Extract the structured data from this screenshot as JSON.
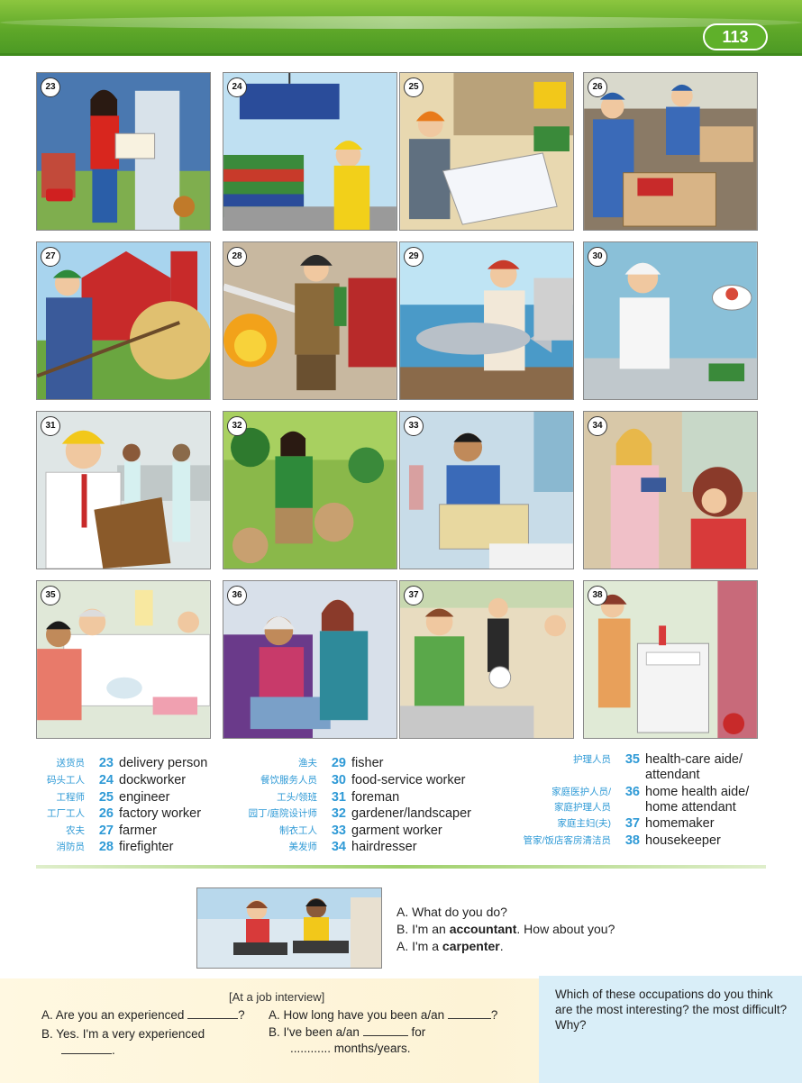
{
  "page_number": "113",
  "pictures": [
    {
      "num": "23",
      "name": "delivery-person"
    },
    {
      "num": "24",
      "name": "dockworker"
    },
    {
      "num": "25",
      "name": "engineer"
    },
    {
      "num": "26",
      "name": "factory-worker"
    },
    {
      "num": "27",
      "name": "farmer"
    },
    {
      "num": "28",
      "name": "firefighter"
    },
    {
      "num": "29",
      "name": "fisher"
    },
    {
      "num": "30",
      "name": "food-service-worker"
    },
    {
      "num": "31",
      "name": "foreman"
    },
    {
      "num": "32",
      "name": "gardener"
    },
    {
      "num": "33",
      "name": "garment-worker"
    },
    {
      "num": "34",
      "name": "hairdresser"
    },
    {
      "num": "35",
      "name": "health-care-aide"
    },
    {
      "num": "36",
      "name": "home-health-aide"
    },
    {
      "num": "37",
      "name": "homemaker"
    },
    {
      "num": "38",
      "name": "housekeeper"
    }
  ],
  "legend": {
    "col1": [
      {
        "zh": "送货员",
        "num": "23",
        "en": "delivery person"
      },
      {
        "zh": "码头工人",
        "num": "24",
        "en": "dockworker"
      },
      {
        "zh": "工程师",
        "num": "25",
        "en": "engineer"
      },
      {
        "zh": "工厂工人",
        "num": "26",
        "en": "factory worker"
      },
      {
        "zh": "农夫",
        "num": "27",
        "en": "farmer"
      },
      {
        "zh": "消防员",
        "num": "28",
        "en": "firefighter"
      }
    ],
    "col2": [
      {
        "zh": "渔夫",
        "num": "29",
        "en": "fisher"
      },
      {
        "zh": "餐饮服务人员",
        "num": "30",
        "en": "food-service worker"
      },
      {
        "zh": "工头/领班",
        "num": "31",
        "en": "foreman"
      },
      {
        "zh": "园丁/庭院设计师",
        "num": "32",
        "en": "gardener/landscaper"
      },
      {
        "zh": "制衣工人",
        "num": "33",
        "en": "garment worker"
      },
      {
        "zh": "美发师",
        "num": "34",
        "en": "hairdresser"
      }
    ],
    "col3": [
      {
        "zh": "护理人员",
        "num": "35",
        "en": "health-care aide/",
        "en2": "attendant"
      },
      {
        "zh": "家庭医护人员/",
        "zh2": "家庭护理人员",
        "num": "36",
        "en": "home health aide/",
        "en2": "home attendant"
      },
      {
        "zh": "家庭主妇(夫)",
        "num": "37",
        "en": "homemaker"
      },
      {
        "zh": "管家/饭店客房清洁员",
        "num": "38",
        "en": "housekeeper"
      }
    ]
  },
  "conversation": {
    "a1": "A. What do you do?",
    "b_pre": "B. I'm an ",
    "b_bold": "accountant",
    "b_post": ". How about you?",
    "a2_pre": "A. I'm a ",
    "a2_bold": "carpenter",
    "a2_post": "."
  },
  "interview": {
    "heading": "[At a job interview]",
    "a1_pre": "A.  Are you an experienced",
    "a1_post": "?",
    "b1": "B.  Yes. I'm a very experienced",
    "b1_end": ".",
    "a2_pre": "A.  How long have you been a/an",
    "a2_post": "?",
    "b2_pre": "B.  I've been  a/an",
    "b2_post": "for",
    "b2_line2": "............ months/years."
  },
  "question": "Which of these occupations do you think are the most interesting? the most difficult? Why?"
}
